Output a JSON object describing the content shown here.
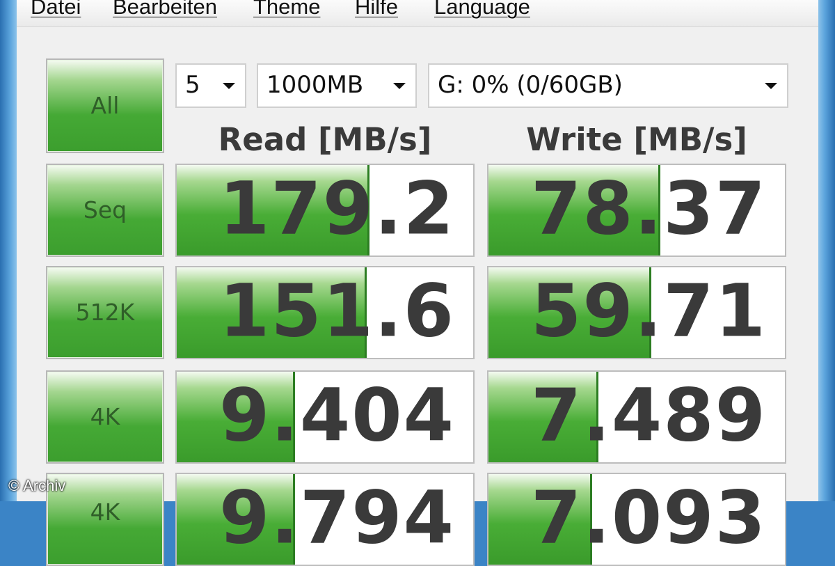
{
  "menu": [
    "Datei",
    "Bearbeiten",
    "Theme",
    "Hilfe",
    "Language"
  ],
  "controls": {
    "count": "5",
    "size": "1000MB",
    "drive": "G: 0% (0/60GB)"
  },
  "buttons": {
    "all": "All",
    "seq": "Seq",
    "k512": "512K",
    "k4": "4K",
    "k4qd": "4K"
  },
  "headers": {
    "read": "Read [MB/s]",
    "write": "Write [MB/s]"
  },
  "results": {
    "seq": {
      "read": "179.2",
      "write": "78.37",
      "read_fill": 0.65,
      "write_fill": 0.58
    },
    "k512": {
      "read": "151.6",
      "write": "59.71",
      "read_fill": 0.64,
      "write_fill": 0.55
    },
    "k4": {
      "read": "9.404",
      "write": "7.489",
      "read_fill": 0.4,
      "write_fill": 0.37
    },
    "k4qd": {
      "read": "9.794",
      "write": "7.093",
      "read_fill": 0.4,
      "write_fill": 0.35
    }
  },
  "watermark": "© Archiv"
}
